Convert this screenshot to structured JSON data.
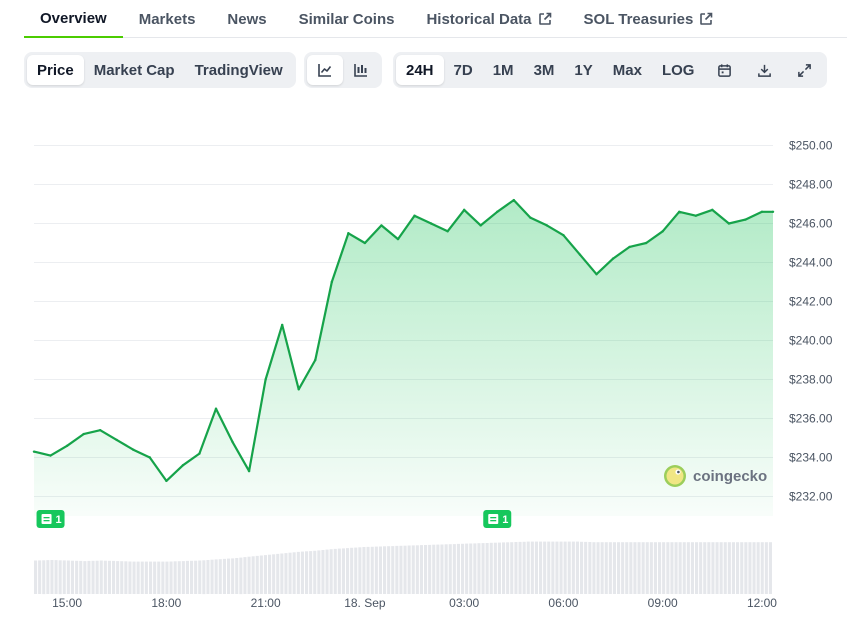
{
  "tabs": [
    {
      "label": "Overview",
      "active": true,
      "external": false
    },
    {
      "label": "Markets",
      "active": false,
      "external": false
    },
    {
      "label": "News",
      "active": false,
      "external": false
    },
    {
      "label": "Similar Coins",
      "active": false,
      "external": false
    },
    {
      "label": "Historical Data",
      "active": false,
      "external": true
    },
    {
      "label": "SOL Treasuries",
      "active": false,
      "external": true
    }
  ],
  "view_toggle": [
    {
      "label": "Price",
      "selected": true
    },
    {
      "label": "Market Cap",
      "selected": false
    },
    {
      "label": "TradingView",
      "selected": false
    }
  ],
  "chart_style": [
    {
      "icon": "line-chart-icon",
      "selected": true
    },
    {
      "icon": "candlestick-chart-icon",
      "selected": false
    }
  ],
  "ranges": [
    {
      "label": "24H",
      "selected": true
    },
    {
      "label": "7D",
      "selected": false
    },
    {
      "label": "1M",
      "selected": false
    },
    {
      "label": "3M",
      "selected": false
    },
    {
      "label": "1Y",
      "selected": false
    },
    {
      "label": "Max",
      "selected": false
    },
    {
      "label": "LOG",
      "selected": false
    }
  ],
  "tool_icons": [
    "calendar-icon",
    "download-icon",
    "fullscreen-icon"
  ],
  "watermark": {
    "text": "coingecko"
  },
  "colors": {
    "accent": "#4bcc00",
    "line": "#16a34a",
    "badge": "#16c75c",
    "volume": "#e5e7eb"
  },
  "chart_data": {
    "type": "area",
    "x": [
      "14:00",
      "14:30",
      "15:00",
      "15:30",
      "16:00",
      "16:30",
      "17:00",
      "17:30",
      "18:00",
      "18:30",
      "19:00",
      "19:30",
      "20:00",
      "20:30",
      "21:00",
      "21:30",
      "22:00",
      "22:30",
      "23:00",
      "23:30",
      "00:00",
      "00:30",
      "01:00",
      "01:30",
      "02:00",
      "02:30",
      "03:00",
      "03:30",
      "04:00",
      "04:30",
      "05:00",
      "05:30",
      "06:00",
      "06:30",
      "07:00",
      "07:30",
      "08:00",
      "08:30",
      "09:00",
      "09:30",
      "10:00",
      "10:30",
      "11:00",
      "11:30",
      "12:00",
      "12:20"
    ],
    "series": [
      {
        "values": [
          234.3,
          234.1,
          234.6,
          235.2,
          235.4,
          234.9,
          234.4,
          234.0,
          232.8,
          233.6,
          234.2,
          236.5,
          234.8,
          233.3,
          238.0,
          240.8,
          237.5,
          239.0,
          243.0,
          245.5,
          245.0,
          245.9,
          245.2,
          246.4,
          246.0,
          245.6,
          246.7,
          245.9,
          246.6,
          247.2,
          246.3,
          245.9,
          245.4,
          244.4,
          243.4,
          244.2,
          244.8,
          245.0,
          245.6,
          246.6,
          246.4,
          246.7,
          246.0,
          246.2,
          246.6,
          246.6
        ]
      }
    ],
    "volume_relative": [
      0.62,
      0.63,
      0.62,
      0.61,
      0.62,
      0.61,
      0.6,
      0.6,
      0.6,
      0.61,
      0.62,
      0.64,
      0.66,
      0.69,
      0.72,
      0.75,
      0.78,
      0.8,
      0.83,
      0.85,
      0.87,
      0.88,
      0.89,
      0.9,
      0.91,
      0.92,
      0.93,
      0.94,
      0.95,
      0.96,
      0.97,
      0.97,
      0.97,
      0.97,
      0.96,
      0.96,
      0.96,
      0.96,
      0.96,
      0.96,
      0.96,
      0.96,
      0.96,
      0.96,
      0.96,
      0.96
    ],
    "ylim": [
      231.0,
      251.0
    ],
    "y_ticks": [
      232,
      234,
      236,
      238,
      240,
      242,
      244,
      246,
      248,
      250
    ],
    "y_tick_labels": [
      "$232.00",
      "$234.00",
      "$236.00",
      "$238.00",
      "$240.00",
      "$242.00",
      "$244.00",
      "$246.00",
      "$248.00",
      "$250.00"
    ],
    "x_ticks": [
      {
        "label": "15:00",
        "at": "15:00"
      },
      {
        "label": "18:00",
        "at": "18:00"
      },
      {
        "label": "21:00",
        "at": "21:00"
      },
      {
        "label": "18. Sep",
        "at": "00:00"
      },
      {
        "label": "03:00",
        "at": "03:00"
      },
      {
        "label": "06:00",
        "at": "06:00"
      },
      {
        "label": "09:00",
        "at": "09:00"
      },
      {
        "label": "12:00",
        "at": "12:00"
      }
    ],
    "events": [
      {
        "at": "14:30",
        "count": "1"
      },
      {
        "at": "04:00",
        "count": "1"
      }
    ],
    "grid": true
  }
}
